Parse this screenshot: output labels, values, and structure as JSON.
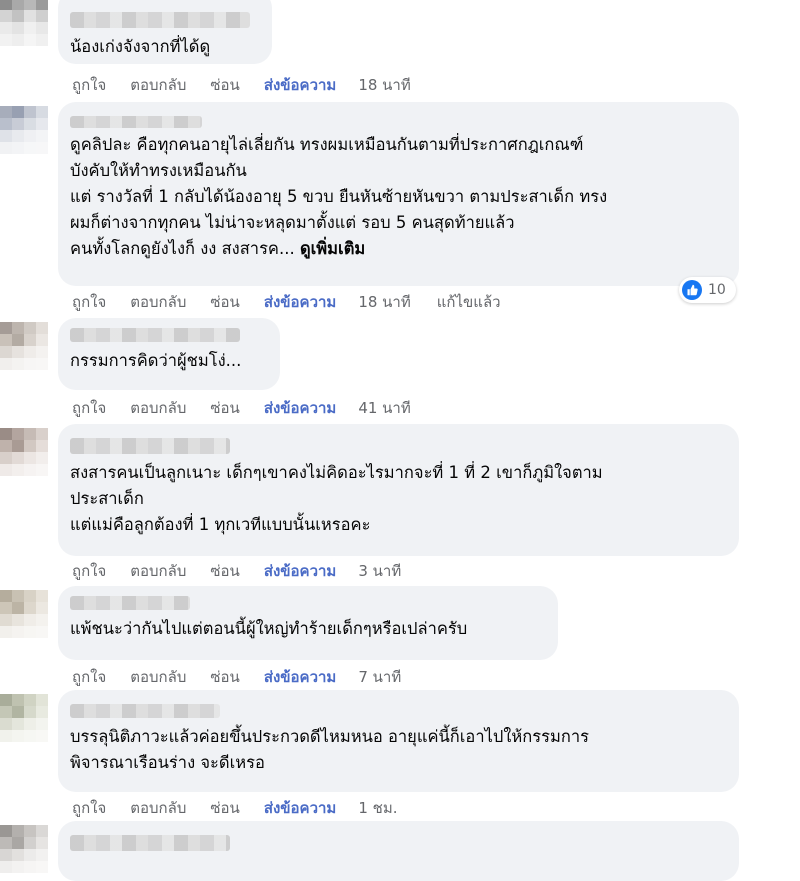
{
  "actions": {
    "like": "ถูกใจ",
    "reply": "ตอบกลับ",
    "hide": "ซ่อน",
    "send_message": "ส่งข้อความ"
  },
  "comments": [
    {
      "text": "น้องเก่งจังจากที่ได้ดู",
      "time": "18 นาที"
    },
    {
      "text": "ดูคลิปละ คือทุกคนอายุไล่เลี่ยกัน ทรงผมเหมือนกันตามที่ประกาศกฎเกณฑ์\nบังคับให้ทำทรงเหมือนกัน\nแต่ รางวัลที่ 1 กลับได้น้องอายุ 5 ขวบ ยืนหันซ้ายหันขวา ตามประสาเด็ก ทรง\nผมก็ต่างจากทุกคน ไม่น่าจะหลุดมาตั้งแต่ รอบ 5 คนสุดท้ายแล้ว\nคนทั้งโลกดูยังไงก็ งง สงสารค... ",
      "see_more": "ดูเพิ่มเติม",
      "time": "18 นาที",
      "edited": "แก้ไขแล้ว",
      "reaction_count": "10"
    },
    {
      "text": "กรรมการคิดว่าผู้ชมโง่...",
      "time": "41 นาที"
    },
    {
      "text": "สงสารคนเป็นลูกเนาะ เด็กๆเขาคงไม่คิดอะไรมากจะที่ 1 ที่ 2 เขาก็ภูมิใจตาม\nประสาเด็ก\nแต่แม่คือลูกต้องที่ 1 ทุกเวทีแบบนั้นเหรอคะ",
      "time": "3 นาที"
    },
    {
      "text": "แพ้ชนะว่ากันไปแต่ตอนนี้ผู้ใหญ่ทำร้ายเด็กๆหรือเปล่าครับ",
      "time": "7 นาที"
    },
    {
      "text": "บรรลุนิติภาวะแล้วค่อยขึ้นประกวดดีไหมหนอ อายุแค่นี้ก็เอาไปให้กรรมการ\nพิจารณาเรือนร่าง จะดีเหรอ",
      "time": "1 ชม."
    }
  ]
}
